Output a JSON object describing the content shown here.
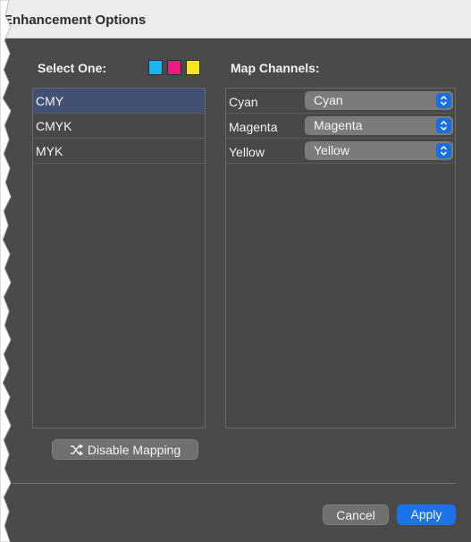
{
  "window": {
    "title": "Enhancement Options"
  },
  "left_panel": {
    "heading": "Select One:",
    "swatches": [
      {
        "name": "cyan",
        "color": "#19b5f0"
      },
      {
        "name": "magenta",
        "color": "#f0197f"
      },
      {
        "name": "yellow",
        "color": "#f7e61b"
      }
    ],
    "options": [
      {
        "label": "CMY",
        "selected": true
      },
      {
        "label": "CMYK",
        "selected": false
      },
      {
        "label": "MYK",
        "selected": false
      }
    ],
    "disable_button": {
      "label": "Disable Mapping",
      "icon": "shuffle-icon"
    }
  },
  "right_panel": {
    "heading": "Map Channels:",
    "rows": [
      {
        "label": "Cyan",
        "value": "Cyan"
      },
      {
        "label": "Magenta",
        "value": "Magenta"
      },
      {
        "label": "Yellow",
        "value": "Yellow"
      }
    ]
  },
  "footer": {
    "cancel_label": "Cancel",
    "apply_label": "Apply"
  },
  "colors": {
    "accent": "#1a73e8",
    "selection": "#425173",
    "panel": "#4a4a4a"
  }
}
